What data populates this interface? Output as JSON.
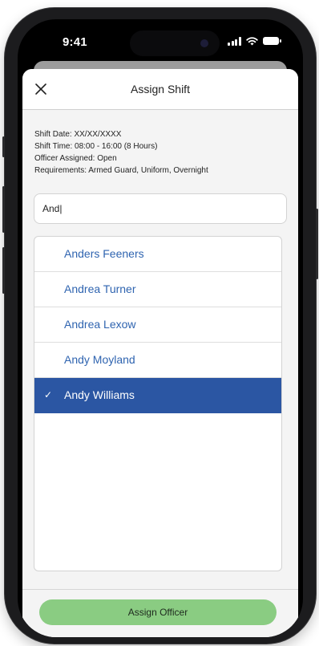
{
  "status_bar": {
    "time": "9:41",
    "icons": [
      "signal-icon",
      "wifi-icon",
      "battery-icon"
    ]
  },
  "header": {
    "title": "Assign Shift",
    "close_icon": "close-icon"
  },
  "shift": {
    "date": "Shift Date: XX/XX/XXXX",
    "time": "Shift Time: 08:00 - 16:00 (8 Hours)",
    "officer": "Officer Assigned: Open",
    "requirements": "Requirements: Armed Guard, Uniform, Overnight"
  },
  "search": {
    "value": "And|"
  },
  "results": {
    "items": [
      {
        "name": "Anders Feeners",
        "selected": false
      },
      {
        "name": "Andrea Turner",
        "selected": false
      },
      {
        "name": "Andrea Lexow",
        "selected": false
      },
      {
        "name": "Andy Moyland",
        "selected": false
      },
      {
        "name": "Andy Williams",
        "selected": true
      }
    ],
    "check_mark": "✓"
  },
  "footer": {
    "assign_label": "Assign Officer"
  },
  "colors": {
    "selected_row": "#2b56a3",
    "result_text": "#2f64b0",
    "assign_button": "#8acc82"
  }
}
